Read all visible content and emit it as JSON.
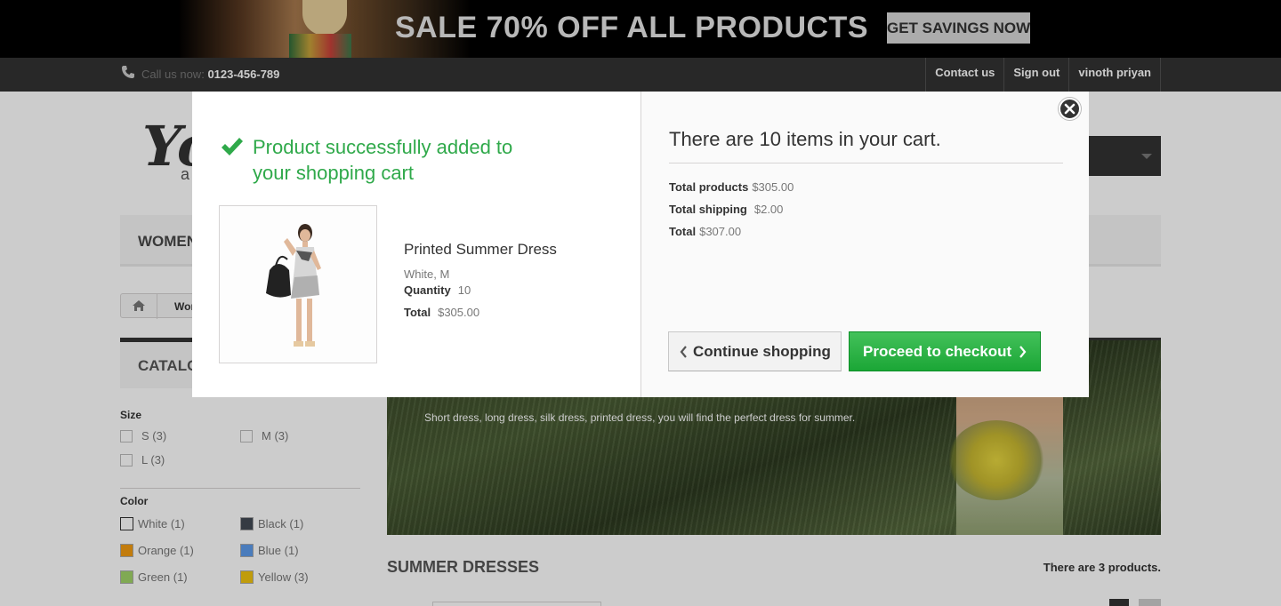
{
  "banner": {
    "text": "SALE 70% OFF ALL PRODUCTS",
    "cta_label": "GET SAVINGS NOW"
  },
  "topnav": {
    "call_prefix": "Call us now:",
    "phone": "0123-456-789",
    "links": [
      "Contact us",
      "Sign out",
      "vinoth priyan"
    ]
  },
  "page": {
    "logo_text": "Yo",
    "logo_sub": "a",
    "menu_first": "WOMEN",
    "breadcrumb_text": "Wom",
    "catalog_title": "CATALOG",
    "filters": {
      "size_title": "Size",
      "sizes": [
        "S (3)",
        "M (3)",
        "L (3)"
      ],
      "color_title": "Color",
      "colors": [
        {
          "label": "White (1)",
          "hex": "#ffffff"
        },
        {
          "label": "Black (1)",
          "hex": "#434a54"
        },
        {
          "label": "Orange (1)",
          "hex": "#f39c11"
        },
        {
          "label": "Blue (1)",
          "hex": "#5d9cec"
        },
        {
          "label": "Green (1)",
          "hex": "#a0d468"
        },
        {
          "label": "Yellow (3)",
          "hex": "#f1c40f"
        }
      ]
    },
    "hero_text": "Short dress, long dress, silk dress, printed dress, you will find the perfect dress for summer.",
    "category_title": "SUMMER DRESSES",
    "products_count": "There are 3 products."
  },
  "modal": {
    "success_message": "Product successfully added to your shopping cart",
    "product": {
      "name": "Printed Summer Dress",
      "attributes": "White, M",
      "quantity_label": "Quantity",
      "quantity": "10",
      "total_label": "Total",
      "total": "$305.00"
    },
    "cart": {
      "count_text": "There are 10 items in your cart.",
      "total_products_label": "Total products",
      "total_products": "$305.00",
      "total_shipping_label": "Total shipping",
      "total_shipping": "$2.00",
      "total_label": "Total",
      "total": "$307.00"
    },
    "continue_label": "Continue shopping",
    "checkout_label": "Proceed to checkout"
  },
  "colors": {
    "success_green": "#2fa94a",
    "checkout_green": "#1ba636",
    "topbar": "#333333"
  }
}
